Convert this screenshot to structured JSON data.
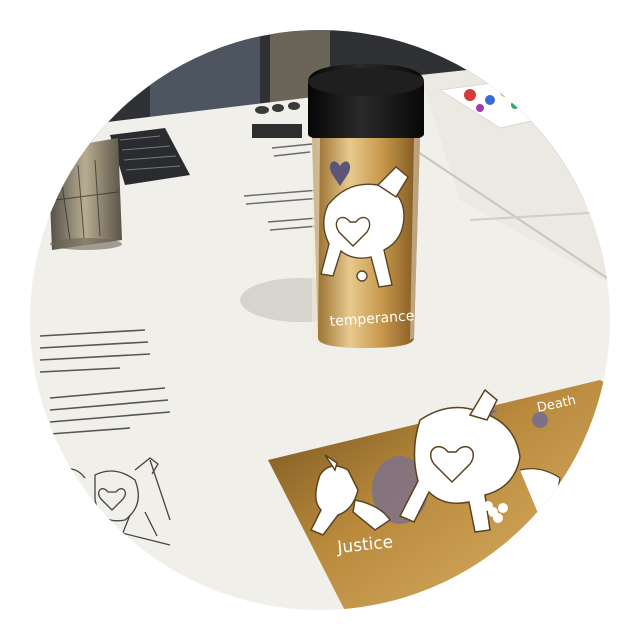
{
  "photo": {
    "tumbler_label": "temperance",
    "card_labels": [
      "Justice",
      "Death"
    ],
    "colors": {
      "table": "#f1efea",
      "gold": "#b98a3c",
      "gold_light": "#e8c98e",
      "lid": "#161616",
      "wall": "#2f3135"
    },
    "icons": [
      "tumbler",
      "heart",
      "horse-figure",
      "unicorn-figure",
      "flower"
    ]
  }
}
